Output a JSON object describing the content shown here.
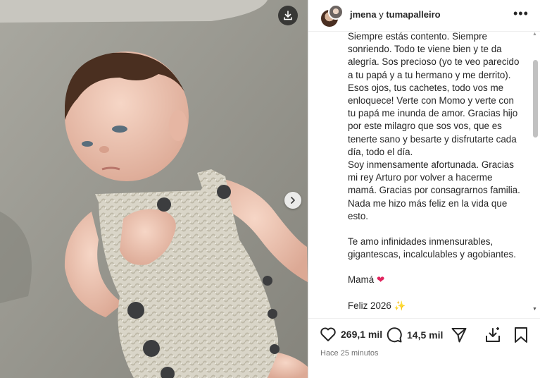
{
  "header": {
    "user1": "jmena",
    "connector": "y",
    "user2": "tumapalleiro",
    "more_label": "•••"
  },
  "caption": {
    "paragraph1": "Siempre estás contento. Siempre sonriendo. Todo te viene bien y te da alegría. Sos precioso (yo te veo parecido a tu papá y a tu hermano y me derrito). Esos ojos, tus cachetes, todo vos me enloquece! Verte con Momo y verte con tu papá me inunda de amor. Gracias hijo por este milagro que sos vos, que es tenerte sano y besarte y disfrutarte cada día, todo el día.",
    "paragraph2": "Soy inmensamente afortunada. Gracias mi rey Arturo por volver a hacerme mamá. Gracias por consagrarnos familia. Nada me hizo más feliz en la vida que esto.",
    "paragraph3": "Te amo infinidades inmensurables, gigantescas, incalculables y agobiantes.",
    "signoff": "Mamá",
    "signoff_emoji": "❤",
    "newyear": "Feliz 2026",
    "newyear_emoji": "✨"
  },
  "actions": {
    "likes": "269,1 mil",
    "comments": "14,5 mil"
  },
  "timestamp": "Hace 25 minutos",
  "icons": [
    "download-icon",
    "chevron-right-icon",
    "heart-icon",
    "comment-icon",
    "share-icon",
    "save-to-collection-icon",
    "bookmark-icon"
  ],
  "colors": {
    "text": "#262626",
    "secondary": "#737373",
    "heart": "#e0245e",
    "border": "#dbdbdb"
  }
}
